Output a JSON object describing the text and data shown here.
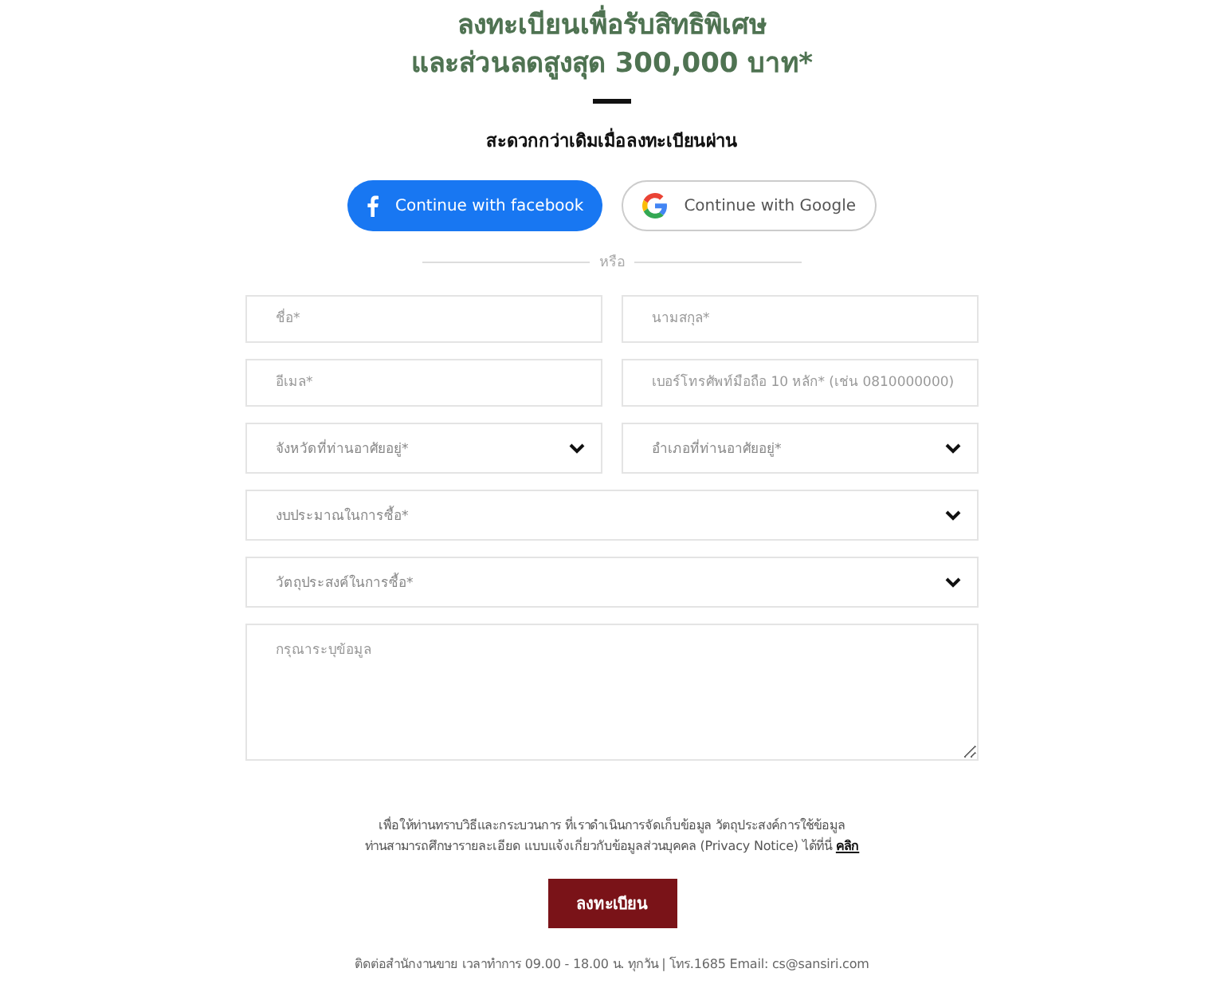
{
  "heading": {
    "lines": [
      "ลงทะเบียนเพื่อรับสิทธิพิเศษ",
      "และส่วนลดสูงสุด 300,000 บาท*"
    ]
  },
  "subtitle": "สะดวกกว่าเดิมเมื่อลงทะเบียนผ่าน",
  "social_buttons": [
    {
      "kind": "facebook",
      "label": "Continue with facebook"
    },
    {
      "kind": "google",
      "label": "Continue with Google"
    }
  ],
  "divider_label": "หรือ",
  "form_rows": [
    [
      {
        "kind": "input",
        "placeholder": "ชื่อ*"
      },
      {
        "kind": "input",
        "placeholder": "นามสกุล*"
      }
    ],
    [
      {
        "kind": "input",
        "placeholder": "อีเมล*"
      },
      {
        "kind": "input",
        "placeholder": "เบอร์โทรศัพท์มือถือ 10 หลัก* (เช่น 0810000000)"
      }
    ],
    [
      {
        "kind": "select",
        "placeholder": "จังหวัดที่ท่านอาศัยอยู่*"
      },
      {
        "kind": "select",
        "placeholder": "อำเภอที่ท่านอาศัยอยู่*"
      }
    ],
    [
      {
        "kind": "select",
        "placeholder": "งบประมาณในการซื้อ*"
      }
    ],
    [
      {
        "kind": "select",
        "placeholder": "วัตถุประสงค์ในการซื้อ*"
      }
    ],
    [
      {
        "kind": "textarea",
        "placeholder": "กรุณาระบุข้อมูล"
      }
    ]
  ],
  "notice": {
    "lines": [
      "เพื่อให้ท่านทราบวิธีและกระบวนการ ที่เราดำเนินการจัดเก็บข้อมูล วัตถุประสงค์การใช้ข้อมูล",
      "ท่านสามารถศึกษารายละเอียด แบบแจ้งเกี่ยวกับข้อมูลส่วนบุคคล (Privacy Notice) ได้ที่นี่"
    ],
    "link": "คลิก"
  },
  "submit_button": "ลงทะเบียน",
  "footer": "ติดต่อสำนักงานขาย เวลาทำการ 09.00 - 18.00 น. ทุกวัน | โทร.1685 Email: cs@sansiri.com"
}
